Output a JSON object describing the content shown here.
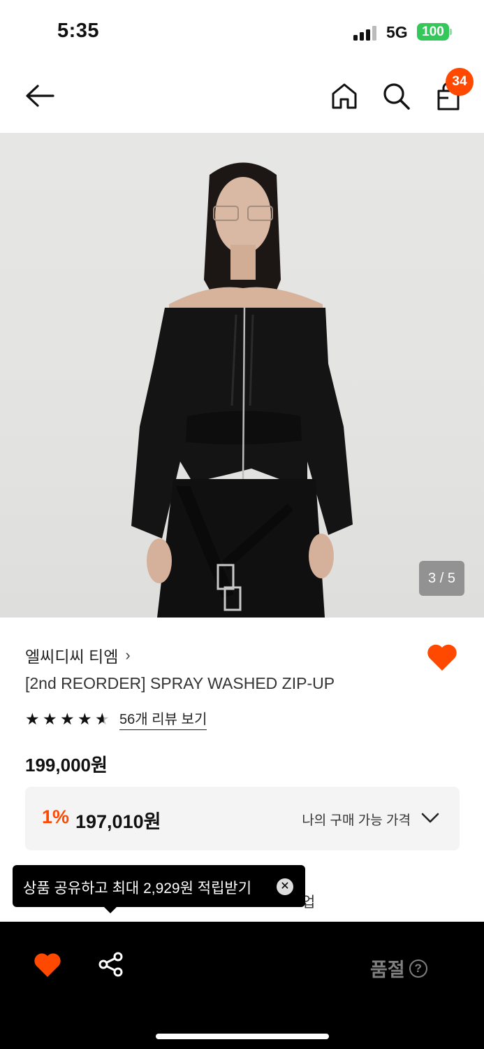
{
  "status_bar": {
    "time": "5:35",
    "network": "5G",
    "battery": "100",
    "icons": [
      "signal-icon",
      "battery-icon"
    ]
  },
  "nav": {
    "cart_count": "34",
    "icons": [
      "back-arrow-icon",
      "home-icon",
      "search-icon",
      "shopping-bag-icon"
    ]
  },
  "gallery": {
    "counter": "3 / 5",
    "image": "photo of model wearing black off-shoulder zip-up sweatshirt with belt"
  },
  "product": {
    "brand": "엘씨디씨 티엠",
    "brand_chevron": "›",
    "title": "[2nd REORDER] SPRAY WASHED ZIP-UP",
    "rating": 4.5,
    "review_link": "56개 리뷰 보기",
    "price": "199,000원"
  },
  "price_box": {
    "discount": "1%",
    "discount_price": "197,010원",
    "my_price_label": "나의 구매 가능 가격"
  },
  "hidden_text": "업",
  "tooltip": {
    "text": "상품 공유하고 최대 2,929원 적립받기",
    "close": "✕"
  },
  "bottom_bar": {
    "soldout_label": "품절",
    "help": "?"
  },
  "colors": {
    "accent": "#ff4800",
    "battery": "#34c759",
    "bottom_bar": "#000000"
  }
}
